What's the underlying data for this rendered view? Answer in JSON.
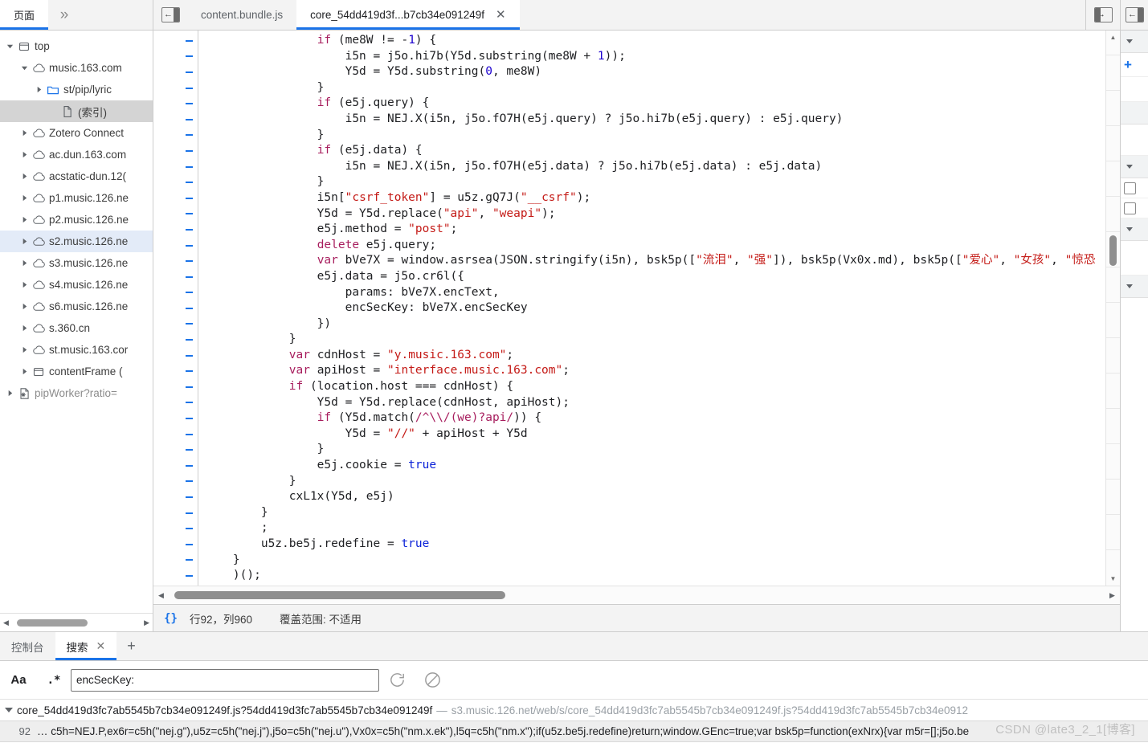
{
  "navigator": {
    "tabs": [
      {
        "label": "页面",
        "active": true
      },
      {
        "label": "»",
        "active": false
      }
    ],
    "tree": [
      {
        "label": "top",
        "icon": "frame-icon",
        "depth": 0,
        "twisty": "down",
        "state": "normal"
      },
      {
        "label": "music.163.com",
        "icon": "cloud-icon",
        "depth": 1,
        "twisty": "down",
        "state": "normal"
      },
      {
        "label": "st/pip/lyric",
        "icon": "folder-icon",
        "depth": 2,
        "twisty": "right",
        "state": "normal"
      },
      {
        "label": "(索引)",
        "icon": "document-icon",
        "depth": 3,
        "twisty": "none",
        "state": "selected"
      },
      {
        "label": "Zotero Connect",
        "icon": "cloud-icon",
        "depth": 1,
        "twisty": "right",
        "state": "normal"
      },
      {
        "label": "ac.dun.163.com",
        "icon": "cloud-icon",
        "depth": 1,
        "twisty": "right",
        "state": "normal"
      },
      {
        "label": "acstatic-dun.12(",
        "icon": "cloud-icon",
        "depth": 1,
        "twisty": "right",
        "state": "normal"
      },
      {
        "label": "p1.music.126.ne",
        "icon": "cloud-icon",
        "depth": 1,
        "twisty": "right",
        "state": "normal"
      },
      {
        "label": "p2.music.126.ne",
        "icon": "cloud-icon",
        "depth": 1,
        "twisty": "right",
        "state": "normal"
      },
      {
        "label": "s2.music.126.ne",
        "icon": "cloud-icon",
        "depth": 1,
        "twisty": "right",
        "state": "highlighted"
      },
      {
        "label": "s3.music.126.ne",
        "icon": "cloud-icon",
        "depth": 1,
        "twisty": "right",
        "state": "normal"
      },
      {
        "label": "s4.music.126.ne",
        "icon": "cloud-icon",
        "depth": 1,
        "twisty": "right",
        "state": "normal"
      },
      {
        "label": "s6.music.126.ne",
        "icon": "cloud-icon",
        "depth": 1,
        "twisty": "right",
        "state": "normal"
      },
      {
        "label": "s.360.cn",
        "icon": "cloud-icon",
        "depth": 1,
        "twisty": "right",
        "state": "normal"
      },
      {
        "label": "st.music.163.cor",
        "icon": "cloud-icon",
        "depth": 1,
        "twisty": "right",
        "state": "normal"
      },
      {
        "label": "contentFrame (",
        "icon": "frame-icon",
        "depth": 1,
        "twisty": "right",
        "state": "normal"
      },
      {
        "label": "pipWorker?ratio=",
        "icon": "worker-icon",
        "depth": 0,
        "twisty": "right",
        "state": "dim"
      }
    ]
  },
  "editor": {
    "tabs": [
      {
        "label": "content.bundle.js",
        "active": false,
        "closable": false
      },
      {
        "label": "core_54dd419d3f...b7cb34e091249f",
        "active": true,
        "closable": true
      }
    ],
    "status": {
      "pretty_print_icon": "{}",
      "cursor": "行92，列960",
      "coverage": "覆盖范围: 不适用"
    },
    "code_lines": [
      [
        {
          "t": "                ",
          "c": "pl"
        },
        {
          "t": "if",
          "c": "k"
        },
        {
          "t": " (me8W != -",
          "c": "pl"
        },
        {
          "t": "1",
          "c": "n"
        },
        {
          "t": ") {",
          "c": "pl"
        }
      ],
      [
        {
          "t": "                    i5n = j5o.hi7b(Y5d.substring(me8W + ",
          "c": "pl"
        },
        {
          "t": "1",
          "c": "n"
        },
        {
          "t": "));",
          "c": "pl"
        }
      ],
      [
        {
          "t": "                    Y5d = Y5d.substring(",
          "c": "pl"
        },
        {
          "t": "0",
          "c": "n"
        },
        {
          "t": ", me8W)",
          "c": "pl"
        }
      ],
      [
        {
          "t": "                }",
          "c": "pl"
        }
      ],
      [
        {
          "t": "                ",
          "c": "pl"
        },
        {
          "t": "if",
          "c": "k"
        },
        {
          "t": " (e5j.query) {",
          "c": "pl"
        }
      ],
      [
        {
          "t": "                    i5n = NEJ.X(i5n, j5o.fO7H(e5j.query) ? j5o.hi7b(e5j.query) : e5j.query)",
          "c": "pl"
        }
      ],
      [
        {
          "t": "                }",
          "c": "pl"
        }
      ],
      [
        {
          "t": "                ",
          "c": "pl"
        },
        {
          "t": "if",
          "c": "k"
        },
        {
          "t": " (e5j.data) {",
          "c": "pl"
        }
      ],
      [
        {
          "t": "                    i5n = NEJ.X(i5n, j5o.fO7H(e5j.data) ? j5o.hi7b(e5j.data) : e5j.data)",
          "c": "pl"
        }
      ],
      [
        {
          "t": "                }",
          "c": "pl"
        }
      ],
      [
        {
          "t": "                i5n[",
          "c": "pl"
        },
        {
          "t": "\"csrf_token\"",
          "c": "s"
        },
        {
          "t": "] = u5z.gQ7J(",
          "c": "pl"
        },
        {
          "t": "\"__csrf\"",
          "c": "s"
        },
        {
          "t": ");",
          "c": "pl"
        }
      ],
      [
        {
          "t": "                Y5d = Y5d.replace(",
          "c": "pl"
        },
        {
          "t": "\"api\"",
          "c": "s"
        },
        {
          "t": ", ",
          "c": "pl"
        },
        {
          "t": "\"weapi\"",
          "c": "s"
        },
        {
          "t": ");",
          "c": "pl"
        }
      ],
      [
        {
          "t": "                e5j.method = ",
          "c": "pl"
        },
        {
          "t": "\"post\"",
          "c": "s"
        },
        {
          "t": ";",
          "c": "pl"
        }
      ],
      [
        {
          "t": "                ",
          "c": "pl"
        },
        {
          "t": "delete",
          "c": "k"
        },
        {
          "t": " e5j.query;",
          "c": "pl"
        }
      ],
      [
        {
          "t": "                ",
          "c": "pl"
        },
        {
          "t": "var",
          "c": "k"
        },
        {
          "t": " bVe7X = window.asrsea(JSON.stringify(i5n), bsk5p([",
          "c": "pl"
        },
        {
          "t": "\"流泪\"",
          "c": "s"
        },
        {
          "t": ", ",
          "c": "pl"
        },
        {
          "t": "\"强\"",
          "c": "s"
        },
        {
          "t": "]), bsk5p(Vx0x.md), bsk5p([",
          "c": "pl"
        },
        {
          "t": "\"爱心\"",
          "c": "s"
        },
        {
          "t": ", ",
          "c": "pl"
        },
        {
          "t": "\"女孩\"",
          "c": "s"
        },
        {
          "t": ", ",
          "c": "pl"
        },
        {
          "t": "\"惊恐",
          "c": "s"
        }
      ],
      [
        {
          "t": "                e5j.data = j5o.cr6l({",
          "c": "pl"
        }
      ],
      [
        {
          "t": "                    params: bVe7X.encText,",
          "c": "pl"
        }
      ],
      [
        {
          "t": "                    encSecKey: bVe7X.encSecKey",
          "c": "pl"
        }
      ],
      [
        {
          "t": "                })",
          "c": "pl"
        }
      ],
      [
        {
          "t": "            }",
          "c": "pl"
        }
      ],
      [
        {
          "t": "            ",
          "c": "pl"
        },
        {
          "t": "var",
          "c": "k"
        },
        {
          "t": " cdnHost = ",
          "c": "pl"
        },
        {
          "t": "\"y.music.163.com\"",
          "c": "s"
        },
        {
          "t": ";",
          "c": "pl"
        }
      ],
      [
        {
          "t": "            ",
          "c": "pl"
        },
        {
          "t": "var",
          "c": "k"
        },
        {
          "t": " apiHost = ",
          "c": "pl"
        },
        {
          "t": "\"interface.music.163.com\"",
          "c": "s"
        },
        {
          "t": ";",
          "c": "pl"
        }
      ],
      [
        {
          "t": "            ",
          "c": "pl"
        },
        {
          "t": "if",
          "c": "k"
        },
        {
          "t": " (location.host === cdnHost) {",
          "c": "pl"
        }
      ],
      [
        {
          "t": "                Y5d = Y5d.replace(cdnHost, apiHost);",
          "c": "pl"
        }
      ],
      [
        {
          "t": "                ",
          "c": "pl"
        },
        {
          "t": "if",
          "c": "k"
        },
        {
          "t": " (Y5d.match(",
          "c": "pl"
        },
        {
          "t": "/^\\\\/(we)?api/",
          "c": "rg"
        },
        {
          "t": ")) {",
          "c": "pl"
        }
      ],
      [
        {
          "t": "                    Y5d = ",
          "c": "pl"
        },
        {
          "t": "\"//\"",
          "c": "s"
        },
        {
          "t": " + apiHost + Y5d",
          "c": "pl"
        }
      ],
      [
        {
          "t": "                }",
          "c": "pl"
        }
      ],
      [
        {
          "t": "                e5j.cookie = ",
          "c": "pl"
        },
        {
          "t": "true",
          "c": "kb"
        }
      ],
      [
        {
          "t": "            }",
          "c": "pl"
        }
      ],
      [
        {
          "t": "            cxL1x(Y5d, e5j)",
          "c": "pl"
        }
      ],
      [
        {
          "t": "        }",
          "c": "pl"
        }
      ],
      [
        {
          "t": "        ;",
          "c": "pl"
        }
      ],
      [
        {
          "t": "        u5z.be5j.redefine = ",
          "c": "pl"
        },
        {
          "t": "true",
          "c": "kb"
        }
      ],
      [
        {
          "t": "    }",
          "c": "pl"
        }
      ],
      [
        {
          "t": "    )();",
          "c": "pl"
        }
      ]
    ]
  },
  "drawer": {
    "tabs": [
      {
        "label": "控制台",
        "active": false,
        "closable": false
      },
      {
        "label": "搜索",
        "active": true,
        "closable": true
      }
    ],
    "add_tab_label": "+",
    "search": {
      "match_case_label": "Aa",
      "regex_label": ".*",
      "value": "encSecKey:",
      "placeholder": "",
      "refresh_icon": "refresh-icon",
      "clear_icon": "clear-icon"
    },
    "results": {
      "file": "core_54dd419d3fc7ab5545b7cb34e091249f.js?54dd419d3fc7ab5545b7cb34e091249f",
      "separator": "—",
      "url": "s3.music.126.net/web/s/core_54dd419d3fc7ab5545b7cb34e091249f.js?54dd419d3fc7ab5545b7cb34e0912",
      "rows": [
        {
          "line": "92",
          "snippet": "… c5h=NEJ.P,ex6r=c5h(\"nej.g\"),u5z=c5h(\"nej.j\"),j5o=c5h(\"nej.u\"),Vx0x=c5h(\"nm.x.ek\"),l5q=c5h(\"nm.x\");if(u5z.be5j.redefine)return;window.GEnc=true;var bsk5p=function(exNrx){var m5r=[];j5o.be"
        }
      ]
    }
  },
  "watermark": "CSDN @late3_2_1[博客]",
  "colors": {
    "accent": "#1a73e8",
    "string": "#c41a16",
    "keyword": "#a71d5d",
    "number": "#1c00cf",
    "selection": "#d4d4d4",
    "highlight": "#e3ebf8"
  }
}
